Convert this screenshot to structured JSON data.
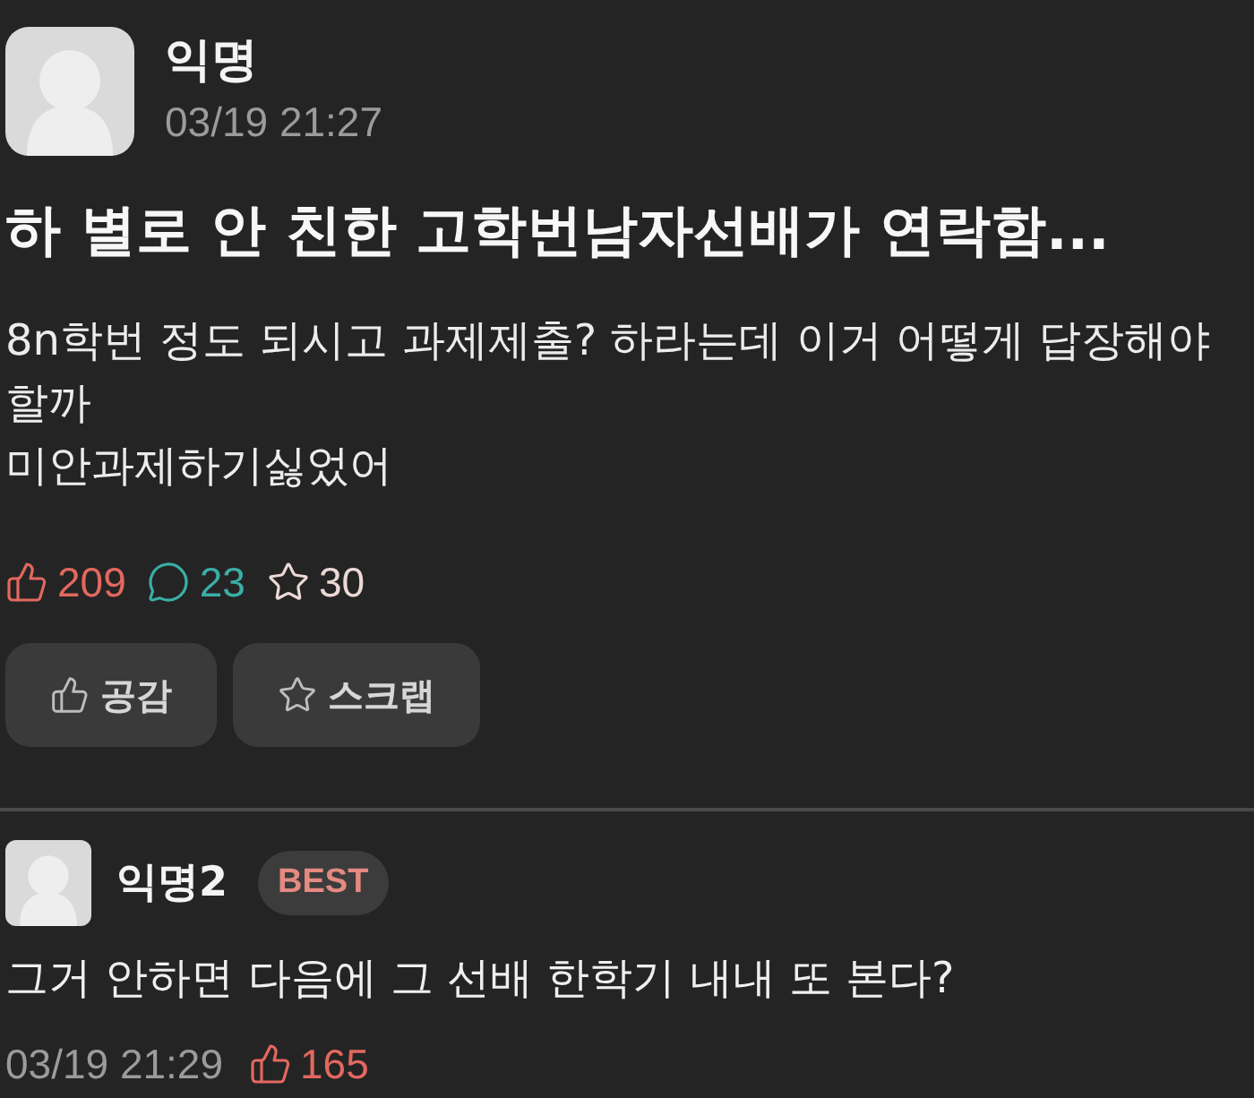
{
  "post": {
    "author": "익명",
    "time": "03/19 21:27",
    "title": "하 별로 안 친한 고학번남자선배가 연락함...",
    "body": [
      "8n학번 정도 되시고 과제제출? 하라는데 이거 어떻게 답장해야 할까",
      "미안과제하기싫었어"
    ],
    "stats": [
      {
        "kind": "like",
        "count": "209",
        "color": "#e3685f"
      },
      {
        "kind": "comment",
        "count": "23",
        "color": "#3aaea6"
      },
      {
        "kind": "scrap",
        "count": "30",
        "color": "#ecd9d6"
      }
    ],
    "actions": [
      {
        "kind": "like",
        "label": "공감"
      },
      {
        "kind": "scrap",
        "label": "스크랩"
      }
    ]
  },
  "comments": [
    {
      "author": "익명2",
      "badge": "BEST",
      "text": "그거 안하면 다음에 그 선배 한학기 내내 또 본다?",
      "time": "03/19 21:29",
      "likes": "165"
    }
  ]
}
